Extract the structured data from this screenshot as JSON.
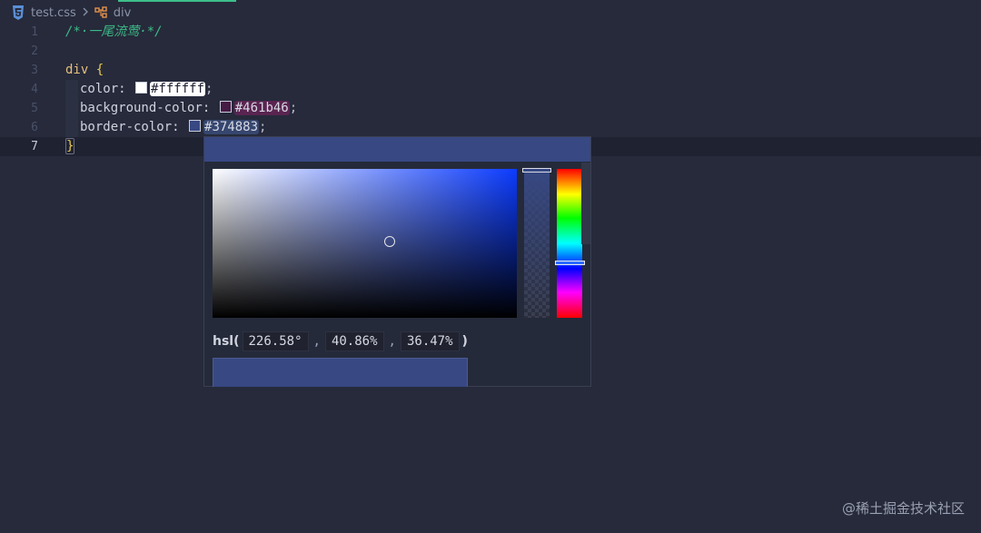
{
  "breadcrumb": {
    "file_icon": "css3-icon",
    "file_name": "test.css",
    "separator_icon": "chevron-right-icon",
    "symbol_icon": "symbol-class-icon",
    "symbol_name": "div"
  },
  "editor": {
    "line_numbers": [
      "1",
      "2",
      "3",
      "4",
      "5",
      "6",
      "7"
    ],
    "active_line": 7,
    "comment": "/*·一尾流莺·*/",
    "selector": "div",
    "open_brace": "{",
    "close_brace": "}",
    "declarations": [
      {
        "property": "color:",
        "value": "#ffffff",
        "swatch": "#ffffff"
      },
      {
        "property": "background-color:",
        "value": "#461b46",
        "swatch": "#461b46"
      },
      {
        "property": "border-color:",
        "value": "#374883",
        "swatch": "#374883"
      }
    ],
    "semicolon": ";"
  },
  "color_picker": {
    "current_color": "#374883",
    "hsl_label": "hsl(",
    "hsl_close": ")",
    "hue": "226.58°",
    "saturation": "40.86%",
    "lightness": "36.47%"
  },
  "watermark": "@稀土掘金技术社区",
  "colors": {
    "background": "#262a3b",
    "comment": "#3dbb86",
    "selector": "#e7c07b",
    "brace": "#e8c94e"
  }
}
